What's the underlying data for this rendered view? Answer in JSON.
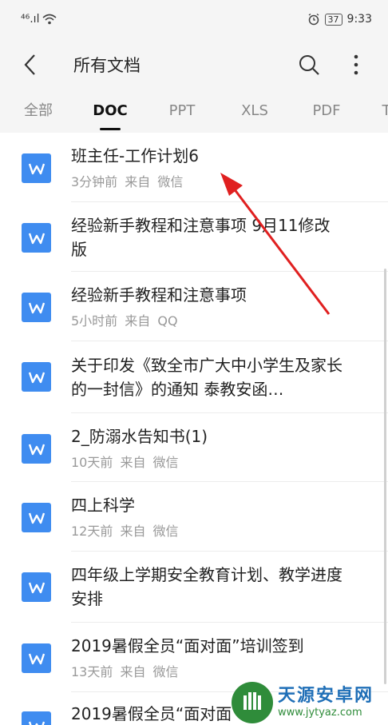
{
  "status_bar": {
    "signal": "⁴⁶.ıl",
    "wifi_icon": "wifi-icon",
    "alarm_icon": "alarm-icon",
    "battery": "37",
    "time": "9:33"
  },
  "header": {
    "title": "所有文档",
    "back_icon": "back-arrow-icon",
    "search_icon": "search-icon",
    "more_icon": "more-vertical-icon"
  },
  "tabs": [
    {
      "label": "全部",
      "active": false
    },
    {
      "label": "DOC",
      "active": true
    },
    {
      "label": "PPT",
      "active": false
    },
    {
      "label": "XLS",
      "active": false
    },
    {
      "label": "PDF",
      "active": false
    },
    {
      "label": "T",
      "active": false
    }
  ],
  "documents": [
    {
      "title": "班主任-工作计划6",
      "meta": "3分钟前 来自 微信"
    },
    {
      "title": "经验新手教程和注意事项 9月11修改版",
      "meta": ""
    },
    {
      "title": "经验新手教程和注意事项",
      "meta": "5小时前 来自 QQ"
    },
    {
      "title": "关于印发《致全市广大中小学生及家长的一封信》的通知 泰教安函…",
      "meta": ""
    },
    {
      "title": "2_防溺水告知书(1)",
      "meta": "10天前 来自 微信"
    },
    {
      "title": "四上科学",
      "meta": "12天前 来自 微信"
    },
    {
      "title": "四年级上学期安全教育计划、教学进度安排",
      "meta": ""
    },
    {
      "title": "2019暑假全员“面对面”培训签到",
      "meta": "13天前 来自 微信"
    },
    {
      "title": "2019暑假全员“面对面",
      "meta": ""
    }
  ],
  "watermark": {
    "title": "天源安卓网",
    "url": "www.jytyaz.com"
  },
  "colors": {
    "doc_icon": "#3f8cf0",
    "arrow": "#e02020",
    "watermark_blue": "#1f6fb7",
    "watermark_green": "#2f8c3a"
  }
}
